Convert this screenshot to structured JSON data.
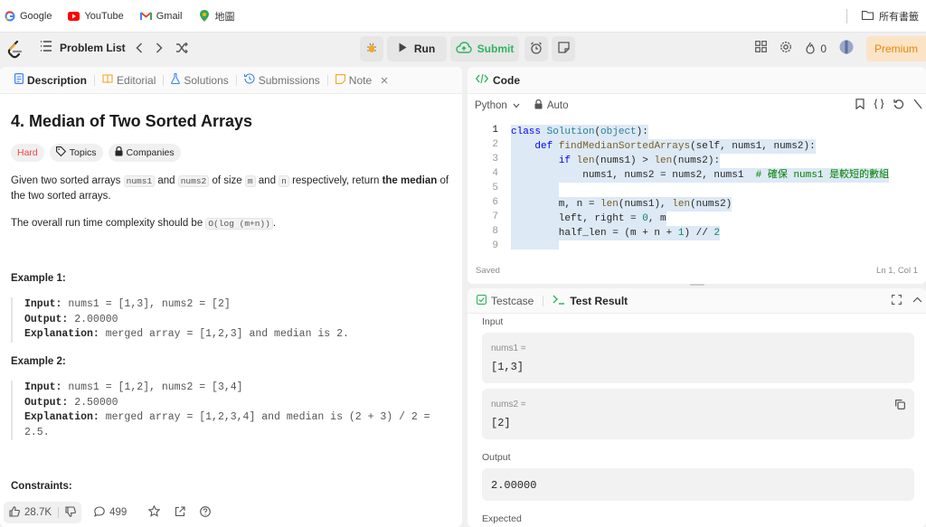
{
  "bookmarks": {
    "items": [
      {
        "label": "Google",
        "icon": "google-icon"
      },
      {
        "label": "YouTube",
        "icon": "youtube-icon"
      },
      {
        "label": "Gmail",
        "icon": "gmail-icon"
      },
      {
        "label": "地圖",
        "icon": "maps-icon"
      }
    ],
    "all_bookmarks": "所有書籤"
  },
  "nav": {
    "problem_list": "Problem List",
    "run": "Run",
    "submit": "Submit",
    "streak": "0",
    "premium": "Premium"
  },
  "left": {
    "tabs": [
      {
        "label": "Description",
        "icon": "description-icon"
      },
      {
        "label": "Editorial",
        "icon": "editorial-icon"
      },
      {
        "label": "Solutions",
        "icon": "flask-icon"
      },
      {
        "label": "Submissions",
        "icon": "history-icon"
      },
      {
        "label": "Note",
        "icon": "note-icon"
      }
    ],
    "title": "4. Median of Two Sorted Arrays",
    "difficulty": "Hard",
    "topics": "Topics",
    "companies": "Companies",
    "desc": {
      "p1_a": "Given two sorted arrays ",
      "p1_nums1": "nums1",
      "p1_b": " and ",
      "p1_nums2": "nums2",
      "p1_c": " of size ",
      "p1_m": "m",
      "p1_d": " and ",
      "p1_n": "n",
      "p1_e": " respectively, return ",
      "p1_bold": "the median",
      "p1_f": " of the two sorted arrays.",
      "p2_a": "The overall run time complexity should be ",
      "p2_code": "O(log (m+n))",
      "p2_b": "."
    },
    "examples": [
      {
        "heading": "Example 1:",
        "input_label": "Input:",
        "input": " nums1 = [1,3], nums2 = [2]",
        "output_label": "Output:",
        "output": " 2.00000",
        "expl_label": "Explanation:",
        "expl": " merged array = [1,2,3] and median is 2."
      },
      {
        "heading": "Example 2:",
        "input_label": "Input:",
        "input": " nums1 = [1,2], nums2 = [3,4]",
        "output_label": "Output:",
        "output": " 2.50000",
        "expl_label": "Explanation:",
        "expl": " merged array = [1,2,3,4] and median is (2 + 3) / 2 =",
        "expl2": "2.5."
      }
    ],
    "constraints": "Constraints:",
    "likes": "28.7K",
    "comments": "499"
  },
  "code": {
    "header": "Code",
    "language": "Python",
    "mode": "Auto",
    "status": "Saved",
    "cursor": "Ln 1, Col 1",
    "line_numbers": [
      "1",
      "2",
      "3",
      "4",
      "5",
      "6",
      "7",
      "8",
      "9"
    ]
  },
  "test": {
    "tab_testcase": "Testcase",
    "tab_result": "Test Result",
    "input_label": "Input",
    "var1": "nums1 =",
    "val1": "[1,3]",
    "var2": "nums2 =",
    "val2": "[2]",
    "output_label": "Output",
    "output_val": "2.00000",
    "expected_label": "Expected"
  },
  "colors": {
    "accent_green": "#2db55d",
    "hard_red": "#ef4743",
    "premium_orange": "#e8870a",
    "line_highlight": "#dde9f5"
  }
}
